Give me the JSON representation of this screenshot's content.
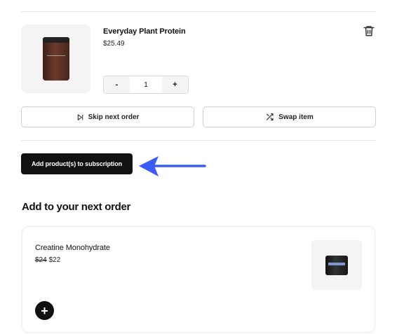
{
  "cart_item": {
    "title": "Everyday Plant Protein",
    "price": "$25.49",
    "quantity": "1",
    "minus_label": "-",
    "plus_label": "+",
    "jar_color": "#5a2e22"
  },
  "actions": {
    "skip_label": "Skip next order",
    "swap_label": "Swap item"
  },
  "primary": {
    "add_products_label": "Add product(s) to subscription"
  },
  "next_order": {
    "title": "Add to your next order",
    "products": [
      {
        "title": "Creatine Monohydrate",
        "old_price": "$24",
        "price": "$22",
        "add_label": "+"
      }
    ]
  },
  "annotation": {
    "arrow_color": "#3b5bfd"
  },
  "icons": [
    "trash-icon",
    "skip-next-icon",
    "shuffle-icon",
    "plus-icon",
    "arrow-pointer-icon"
  ]
}
